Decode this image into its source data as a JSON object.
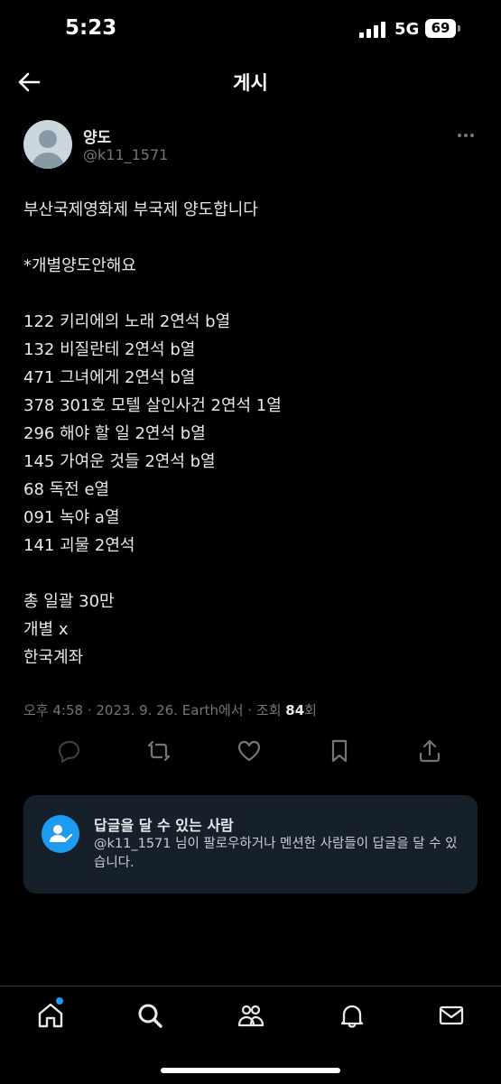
{
  "status_bar": {
    "time": "5:23",
    "network": "5G",
    "battery": "69"
  },
  "header": {
    "title": "게시"
  },
  "author": {
    "display_name": "양도",
    "handle": "@k11_1571"
  },
  "post": {
    "lines": [
      "부산국제영화제 부국제 양도합니다",
      "",
      "*개별양도안해요",
      "",
      "122 키리에의 노래 2연석 b열",
      "132 비질란테 2연석 b열",
      "471 그녀에게 2연석 b열",
      "378 301호 모텔 살인사건 2연석 1열",
      "296 해야 할 일 2연석 b열",
      "145 가여운 것들 2연석 b열",
      "68 독전 e열",
      "091 녹야 a열",
      "141 괴물 2연석",
      "",
      "총 일괄 30만",
      "개별 x",
      "한국계좌"
    ]
  },
  "meta": {
    "timestamp": "오후 4:58 · 2023. 9. 26. Earth에서 · 조회 ",
    "views": "84",
    "views_suffix": "회"
  },
  "reply_settings": {
    "title": "답글을 달 수 있는 사람",
    "description": "@k11_1571 님이 팔로우하거나 멘션한 사람들이 답글을 달 수 있습니다."
  },
  "colors": {
    "accent": "#1d9bf0",
    "card_bg": "#15202b",
    "muted": "#71767b"
  }
}
